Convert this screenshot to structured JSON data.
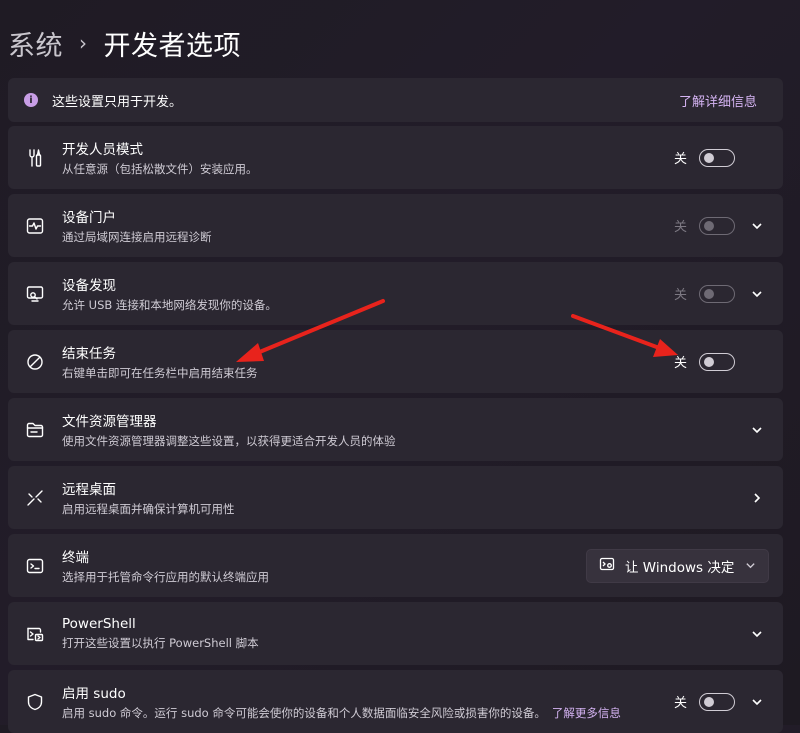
{
  "breadcrumb": {
    "parent": "系统",
    "separator": "›",
    "current": "开发者选项"
  },
  "info": {
    "icon": "info-icon",
    "text": "这些设置只用于开发。",
    "link": "了解详细信息"
  },
  "rows": [
    {
      "icon": "tools-icon",
      "title": "开发人员模式",
      "desc": "从任意源（包括松散文件）安装应用。",
      "toggle_label": "关",
      "toggle_on": false,
      "enabled": true,
      "chevron": false
    },
    {
      "icon": "monitor-pulse-icon",
      "title": "设备门户",
      "desc": "通过局域网连接启用远程诊断",
      "toggle_label": "关",
      "toggle_on": false,
      "enabled": false,
      "chevron": true
    },
    {
      "icon": "device-discovery-icon",
      "title": "设备发现",
      "desc": "允许 USB 连接和本地网络发现你的设备。",
      "toggle_label": "关",
      "toggle_on": false,
      "enabled": false,
      "chevron": true
    },
    {
      "icon": "prohibit-icon",
      "title": "结束任务",
      "desc": "右键单击即可在任务栏中启用结束任务",
      "toggle_label": "关",
      "toggle_on": false,
      "enabled": true,
      "chevron": false
    },
    {
      "icon": "folder-icon",
      "title": "文件资源管理器",
      "desc": "使用文件资源管理器调整这些设置，以获得更适合开发人员的体验",
      "chevron": "down"
    },
    {
      "icon": "remote-desktop-icon",
      "title": "远程桌面",
      "desc": "启用远程桌面并确保计算机可用性",
      "chevron": "right"
    },
    {
      "icon": "terminal-icon",
      "title": "终端",
      "desc": "选择用于托管命令行应用的默认终端应用",
      "dropdown_value": "让 Windows 决定"
    },
    {
      "icon": "powershell-icon",
      "title": "PowerShell",
      "desc": "打开这些设置以执行 PowerShell 脚本",
      "chevron": "down"
    },
    {
      "icon": "shield-icon",
      "title": "启用 sudo",
      "desc": "启用 sudo 命令。运行 sudo 命令可能会使你的设备和个人数据面临安全风险或损害你的设备。",
      "desc_link": "了解更多信息",
      "toggle_label": "关",
      "toggle_on": false,
      "enabled": true,
      "chevron": true
    }
  ],
  "accent_color": "#d4b3f2",
  "annotation_color": "#e8231c"
}
